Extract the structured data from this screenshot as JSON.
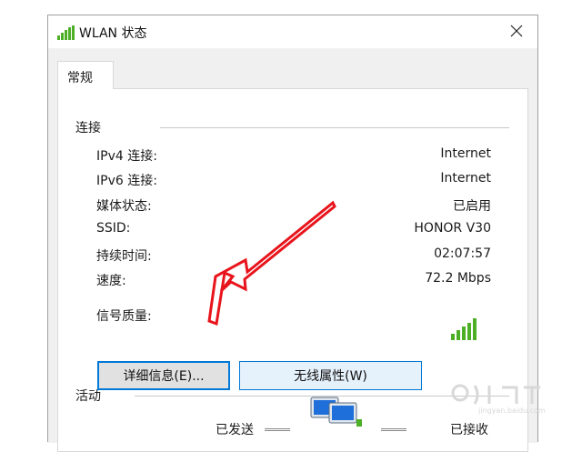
{
  "window": {
    "title": "WLAN 状态",
    "close_glyph": "✕"
  },
  "tabs": [
    {
      "label": "常规",
      "selected": true
    }
  ],
  "connection": {
    "group_title": "连接",
    "rows": [
      {
        "label": "IPv4 连接:",
        "value": "Internet"
      },
      {
        "label": "IPv6 连接:",
        "value": "Internet"
      },
      {
        "label": "媒体状态:",
        "value": "已启用"
      },
      {
        "label": "SSID:",
        "value": "HONOR V30"
      },
      {
        "label": "持续时间:",
        "value": "02:07:57"
      },
      {
        "label": "速度:",
        "value": "72.2 Mbps"
      }
    ],
    "signal_label": "信号质量:",
    "signal_bars": 5,
    "signal_max": 5
  },
  "buttons": {
    "details": "详细信息(E)...",
    "wireless_props": "无线属性(W)"
  },
  "activity": {
    "group_title": "活动",
    "sent_label": "已发送",
    "received_label": "已接收"
  },
  "annotation": {
    "arrow_color": "#e8141c"
  },
  "colors": {
    "accent": "#0078d7",
    "signal_green": "#4caf26",
    "dialog_bg": "#f0f0f0"
  },
  "icons": {
    "title": "wifi-signal-icon",
    "close": "close-icon",
    "signal": "signal-strength-icon",
    "activity": "network-computers-icon"
  }
}
